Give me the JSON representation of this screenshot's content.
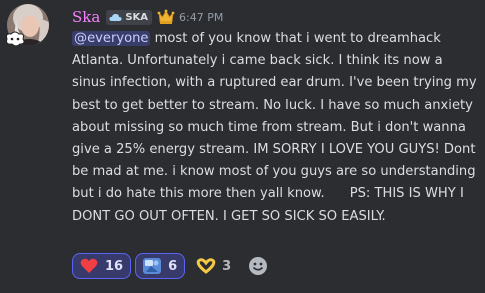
{
  "message": {
    "author": "Ska",
    "tag": "SKA",
    "timestamp": "6:47 PM",
    "mention": "@everyone",
    "body": " most of you know that i went to dreamhack Atlanta. Unfortunately i came back sick. I think its now a sinus infection, with a ruptured ear drum. I've been trying my best to get better to stream. No luck. I have so much anxiety about missing so much time from stream. But i don't wanna give a 25% energy stream. IM SORRY I LOVE YOU GUYS! Dont be mad at me. i know most of you guys are so understanding but i do hate this more then yall know.      PS: THIS IS WHY I DONT GO OUT OFTEN. I GET SO SICK SO EASILY."
  },
  "reactions": [
    {
      "icon": "heart-icon",
      "count": "16",
      "active": true
    },
    {
      "icon": "sick-emoji-icon",
      "count": "6",
      "active": true
    },
    {
      "icon": "hearts-hands-emoji-icon",
      "count": "3",
      "active": false
    }
  ],
  "colors": {
    "background": "#2b2d31",
    "username": "#f47fff",
    "mention": "#c9cdfb",
    "reaction_active_border": "#5865f2"
  }
}
